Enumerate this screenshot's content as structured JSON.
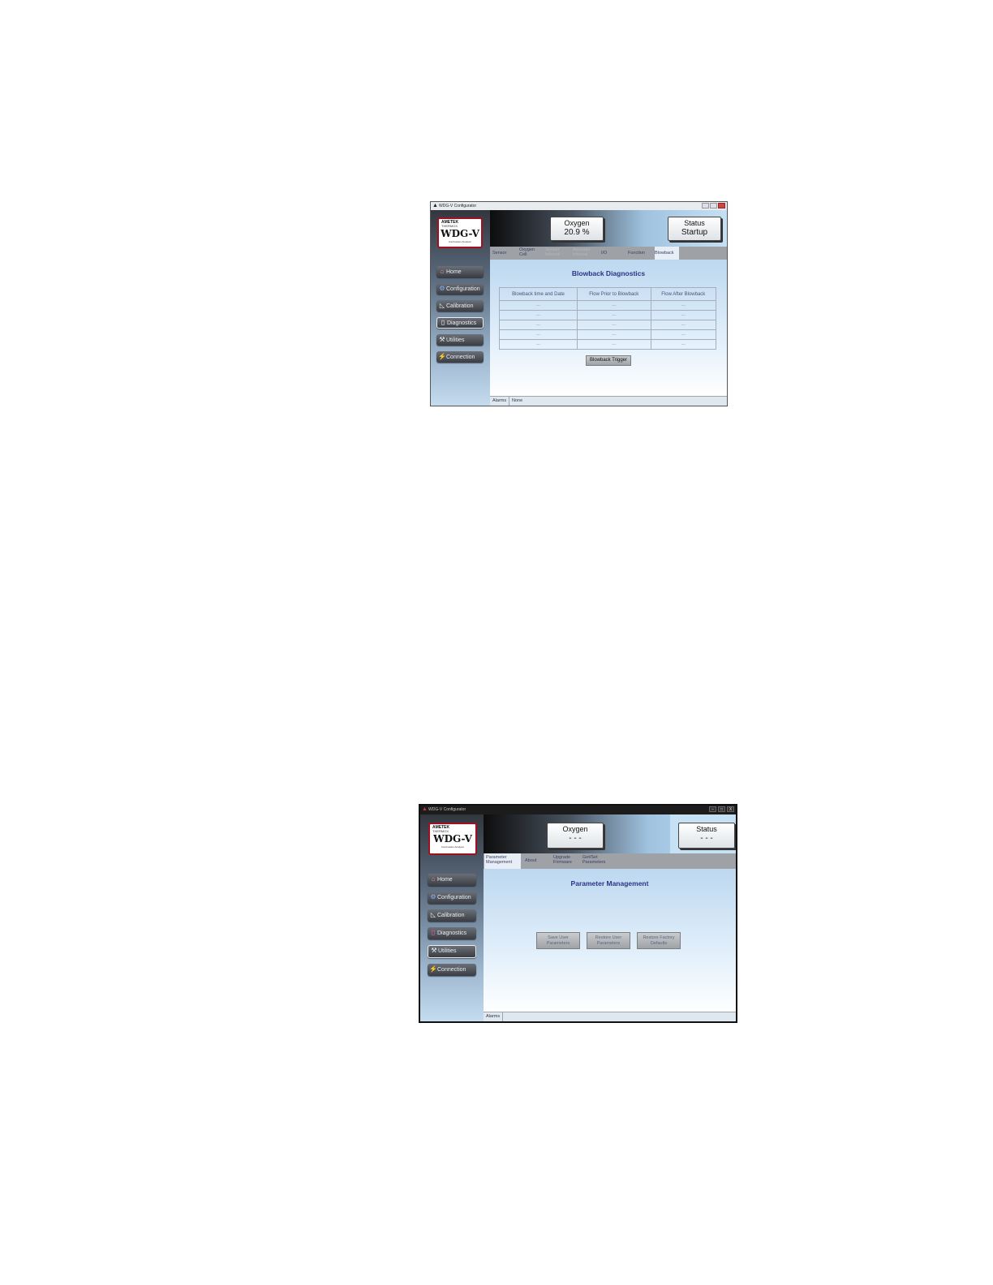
{
  "screen1": {
    "window_title": "WDG-V Configurator",
    "logo": {
      "brand": "AMETEK",
      "brand2": "THERMOX",
      "model": "WDG-V",
      "subtitle": "Combustion Analyzer"
    },
    "nav": [
      {
        "label": "Home",
        "icon": "home-icon"
      },
      {
        "label": "Configuration",
        "icon": "gear-icon"
      },
      {
        "label": "Calibration",
        "icon": "calibration-icon"
      },
      {
        "label": "Diagnostics",
        "icon": "document-icon"
      },
      {
        "label": "Utilities",
        "icon": "wrench-icon"
      },
      {
        "label": "Connection",
        "icon": "plug-icon"
      }
    ],
    "active_nav": "Diagnostics",
    "oxygen": {
      "label": "Oxygen",
      "value": "20.9 %"
    },
    "status": {
      "label": "Status",
      "value": "Startup"
    },
    "tabs": [
      {
        "label": "Sensor"
      },
      {
        "label": "Oxygen Cell"
      },
      {
        "label": "Sensor Internal"
      },
      {
        "label": "Aspirator Internal"
      },
      {
        "label": "I/O"
      },
      {
        "label": "Function"
      },
      {
        "label": "Blowback"
      }
    ],
    "page_title": "Blowback Diagnostics",
    "table": {
      "columns": [
        "Blowback time and Date",
        "Flow Prior to Blowback",
        "Flow After Blowback"
      ],
      "rows": [
        [
          "---",
          "---",
          "---"
        ],
        [
          "---",
          "---",
          "---"
        ],
        [
          "---",
          "---",
          "---"
        ],
        [
          "---",
          "---",
          "---"
        ],
        [
          "---",
          "---",
          "---"
        ]
      ]
    },
    "trigger_button": "Blowback Trigger",
    "alarms": {
      "label": "Alarms",
      "value": "None"
    }
  },
  "screen2": {
    "window_title": "WDG-V Configurator",
    "logo": {
      "brand": "AMETEK",
      "brand2": "THERMOX",
      "model": "WDG-V",
      "subtitle": "Combustion Analyzer"
    },
    "nav": [
      {
        "label": "Home",
        "icon": "home-icon"
      },
      {
        "label": "Configuration",
        "icon": "gear-icon"
      },
      {
        "label": "Calibration",
        "icon": "calibration-icon"
      },
      {
        "label": "Diagnostics",
        "icon": "document-icon"
      },
      {
        "label": "Utilities",
        "icon": "wrench-icon"
      },
      {
        "label": "Connection",
        "icon": "plug-icon"
      }
    ],
    "active_nav": "Utilities",
    "oxygen": {
      "label": "Oxygen",
      "value": "- - -"
    },
    "status": {
      "label": "Status",
      "value": "- - -"
    },
    "tabs": [
      {
        "label": "Parameter Management"
      },
      {
        "label": "About"
      },
      {
        "label": "Upgrade Firmware"
      },
      {
        "label": "Get/Set Parameters"
      }
    ],
    "page_title": "Parameter Management",
    "buttons": [
      {
        "label": "Save User Parameters"
      },
      {
        "label": "Restore User Parameters"
      },
      {
        "label": "Restore Factory Defaults"
      }
    ],
    "alarms": {
      "label": "Alarms"
    },
    "window_controls": {
      "minimize": "–",
      "maximize": "□",
      "close": "X"
    }
  },
  "colors": {
    "accent_title": "#2c3384",
    "logo_border": "#a01020",
    "nav_button": "#3a3d43"
  }
}
